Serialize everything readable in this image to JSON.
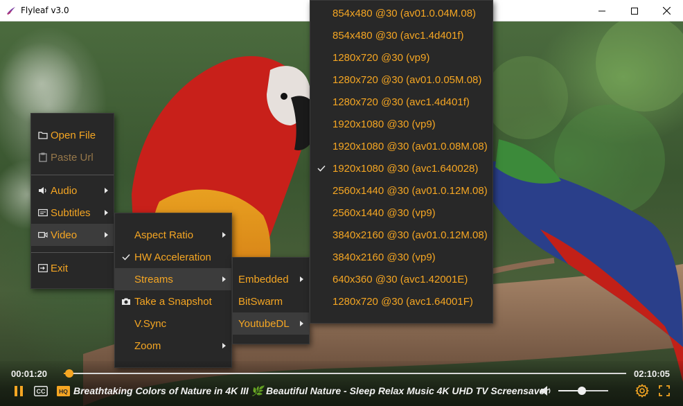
{
  "window": {
    "title": "Flyleaf v3.0",
    "controls": [
      "minimize-icon",
      "maximize-icon",
      "close-icon"
    ]
  },
  "colors": {
    "accent": "#f5a623",
    "menu_bg": "#282828",
    "menu_highlight": "#3c3c3c",
    "disabled": "#97784a"
  },
  "main_menu": {
    "items": [
      {
        "label": "Open File",
        "icon": "folder-icon"
      },
      {
        "label": "Paste Url",
        "icon": "clipboard-icon",
        "disabled": true
      },
      {
        "label": "Audio",
        "icon": "speaker-icon",
        "submenu": true
      },
      {
        "label": "Subtitles",
        "icon": "subtitles-icon",
        "submenu": true
      },
      {
        "label": "Video",
        "icon": "video-camera-icon",
        "submenu": true,
        "highlighted": true
      },
      {
        "label": "Exit",
        "icon": "exit-icon"
      }
    ]
  },
  "video_menu": {
    "items": [
      {
        "label": "Aspect Ratio",
        "submenu": true
      },
      {
        "label": "HW Acceleration",
        "checked": true,
        "icon": "checkmark-icon"
      },
      {
        "label": "Streams",
        "submenu": true,
        "highlighted": true
      },
      {
        "label": "Take a Snapshot",
        "icon": "camera-icon"
      },
      {
        "label": "V.Sync"
      },
      {
        "label": "Zoom",
        "submenu": true
      }
    ]
  },
  "streams_menu": {
    "items": [
      {
        "label": "Embedded",
        "submenu": true
      },
      {
        "label": "BitSwarm"
      },
      {
        "label": "YoutubeDL",
        "submenu": true,
        "highlighted": true
      }
    ]
  },
  "youtubedl_menu": {
    "items": [
      {
        "label": "854x480 @30 (av01.0.04M.08)"
      },
      {
        "label": "854x480 @30 (avc1.4d401f)"
      },
      {
        "label": "1280x720 @30 (vp9)"
      },
      {
        "label": "1280x720 @30 (av01.0.05M.08)"
      },
      {
        "label": "1280x720 @30 (avc1.4d401f)"
      },
      {
        "label": "1920x1080 @30 (vp9)"
      },
      {
        "label": "1920x1080 @30 (av01.0.08M.08)"
      },
      {
        "label": "1920x1080 @30 (avc1.640028)",
        "checked": true
      },
      {
        "label": "2560x1440 @30 (av01.0.12M.08)"
      },
      {
        "label": "2560x1440 @30 (vp9)"
      },
      {
        "label": "3840x2160 @30 (av01.0.12M.08)"
      },
      {
        "label": "3840x2160 @30 (vp9)"
      },
      {
        "label": "640x360 @30 (avc1.42001E)"
      },
      {
        "label": "1280x720 @30 (avc1.64001F)"
      }
    ]
  },
  "player": {
    "current_time": "00:01:20",
    "duration": "02:10:05",
    "progress_fraction": 0.0103,
    "volume_fraction": 0.47,
    "title": "Breathtaking Colors of Nature in 4K III 🌿 Beautiful Nature - Sleep Relax Music 4K UHD TV Screensaver",
    "buttons": {
      "play_pause": "pause-icon",
      "subtitles": "CC",
      "quality": "HQ",
      "volume": "volume-icon",
      "settings": "gear-icon",
      "fullscreen": "fullscreen-icon"
    }
  }
}
